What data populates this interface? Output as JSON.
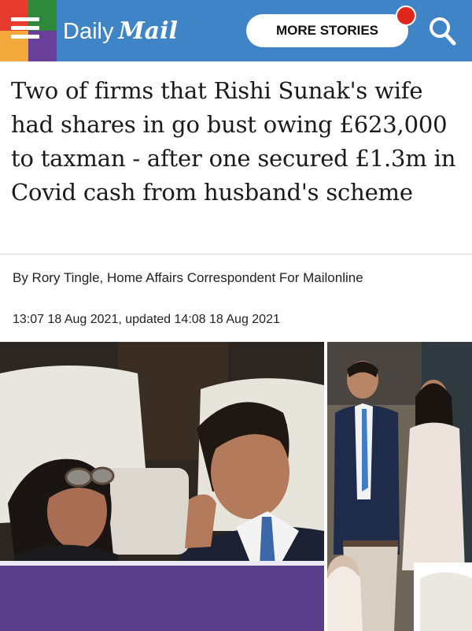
{
  "header": {
    "logo_daily": "Daily",
    "logo_mail": "Mail",
    "more_stories_label": "MORE STORIES",
    "brand_color": "#3f84c6",
    "notification_dot_color": "#e1251b",
    "menu_tile_colors": [
      "#e63b2e",
      "#2e8a3a",
      "#f2a83b",
      "#6a3f9a"
    ]
  },
  "article": {
    "headline": "Two of firms that Rishi Sunak's wife had shares in go bust owing £623,000 to taxman - after one secured £1.3m in Covid cash from husband's scheme",
    "byline": "By Rory Tingle, Home Affairs Correspondent For Mailonline",
    "dateline": "13:07 18 Aug 2021, updated 14:08 18 Aug 2021"
  },
  "icons": {
    "menu": "hamburger-menu-icon",
    "search": "search-icon"
  }
}
